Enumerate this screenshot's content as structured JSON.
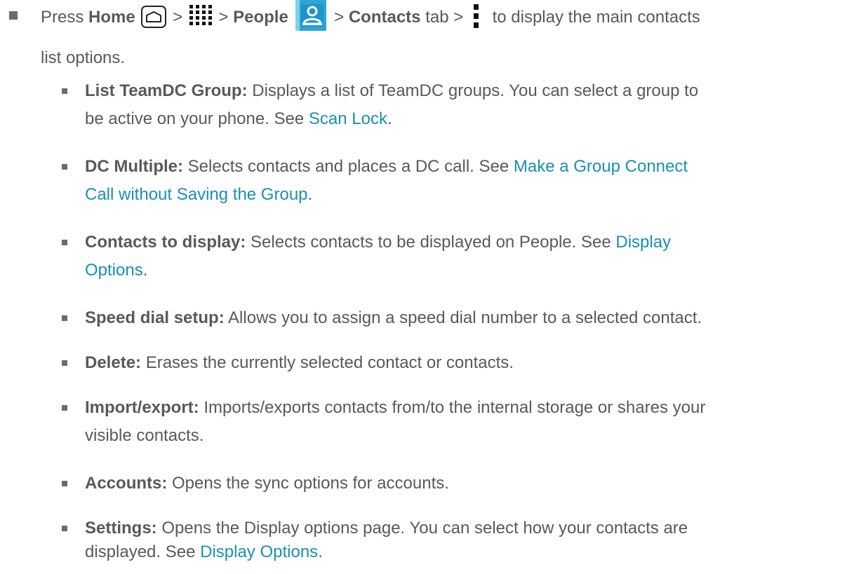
{
  "main": {
    "press": "Press",
    "home": "Home",
    "gt1": ">",
    "gt2": ">",
    "people": "People",
    "gt3": ">",
    "contacts_tab_bold": "Contacts",
    "tab_gt": "tab >",
    "display_tail": "to display the main contacts",
    "line2": "list options."
  },
  "items": [
    {
      "bold": "List TeamDC Group:",
      "text1": " Displays a list of TeamDC groups. You can select a group to",
      "text2": "be active on your phone. See ",
      "link": "Scan Lock",
      "end": "."
    },
    {
      "bold": "DC Multiple:",
      "text1": " Selects contacts and places a DC call. See ",
      "link1": "Make a Group Connect",
      "link2": "Call without Saving the Group",
      "end": "."
    },
    {
      "bold": "Contacts to display:",
      "text1": " Selects contacts to be displayed on People. See ",
      "link1": "Display",
      "link2": "Options",
      "end": "."
    },
    {
      "bold": "Speed dial setup:",
      "text1": " Allows you to assign a speed dial number to a selected contact."
    },
    {
      "bold": "Delete:",
      "text1": " Erases the currently selected contact or contacts."
    },
    {
      "bold": "Import/export:",
      "text1": " Imports/exports contacts from/to the internal storage or shares your",
      "text2": "visible contacts."
    },
    {
      "bold": "Accounts:",
      "text1": " Opens the sync options for accounts."
    },
    {
      "bold": "Settings:",
      "text1": " Opens the Display options page. You can select how your contacts are",
      "text2": "displayed. See ",
      "link": "Display Options",
      "end": "."
    }
  ],
  "icons": {
    "home": "home-icon",
    "apps": "apps-grid-icon",
    "people": "people-app-icon",
    "menu": "overflow-menu-icon"
  },
  "colors": {
    "text": "#595959",
    "link": "#1a8fb3",
    "people_icon": "#29a9d8"
  }
}
